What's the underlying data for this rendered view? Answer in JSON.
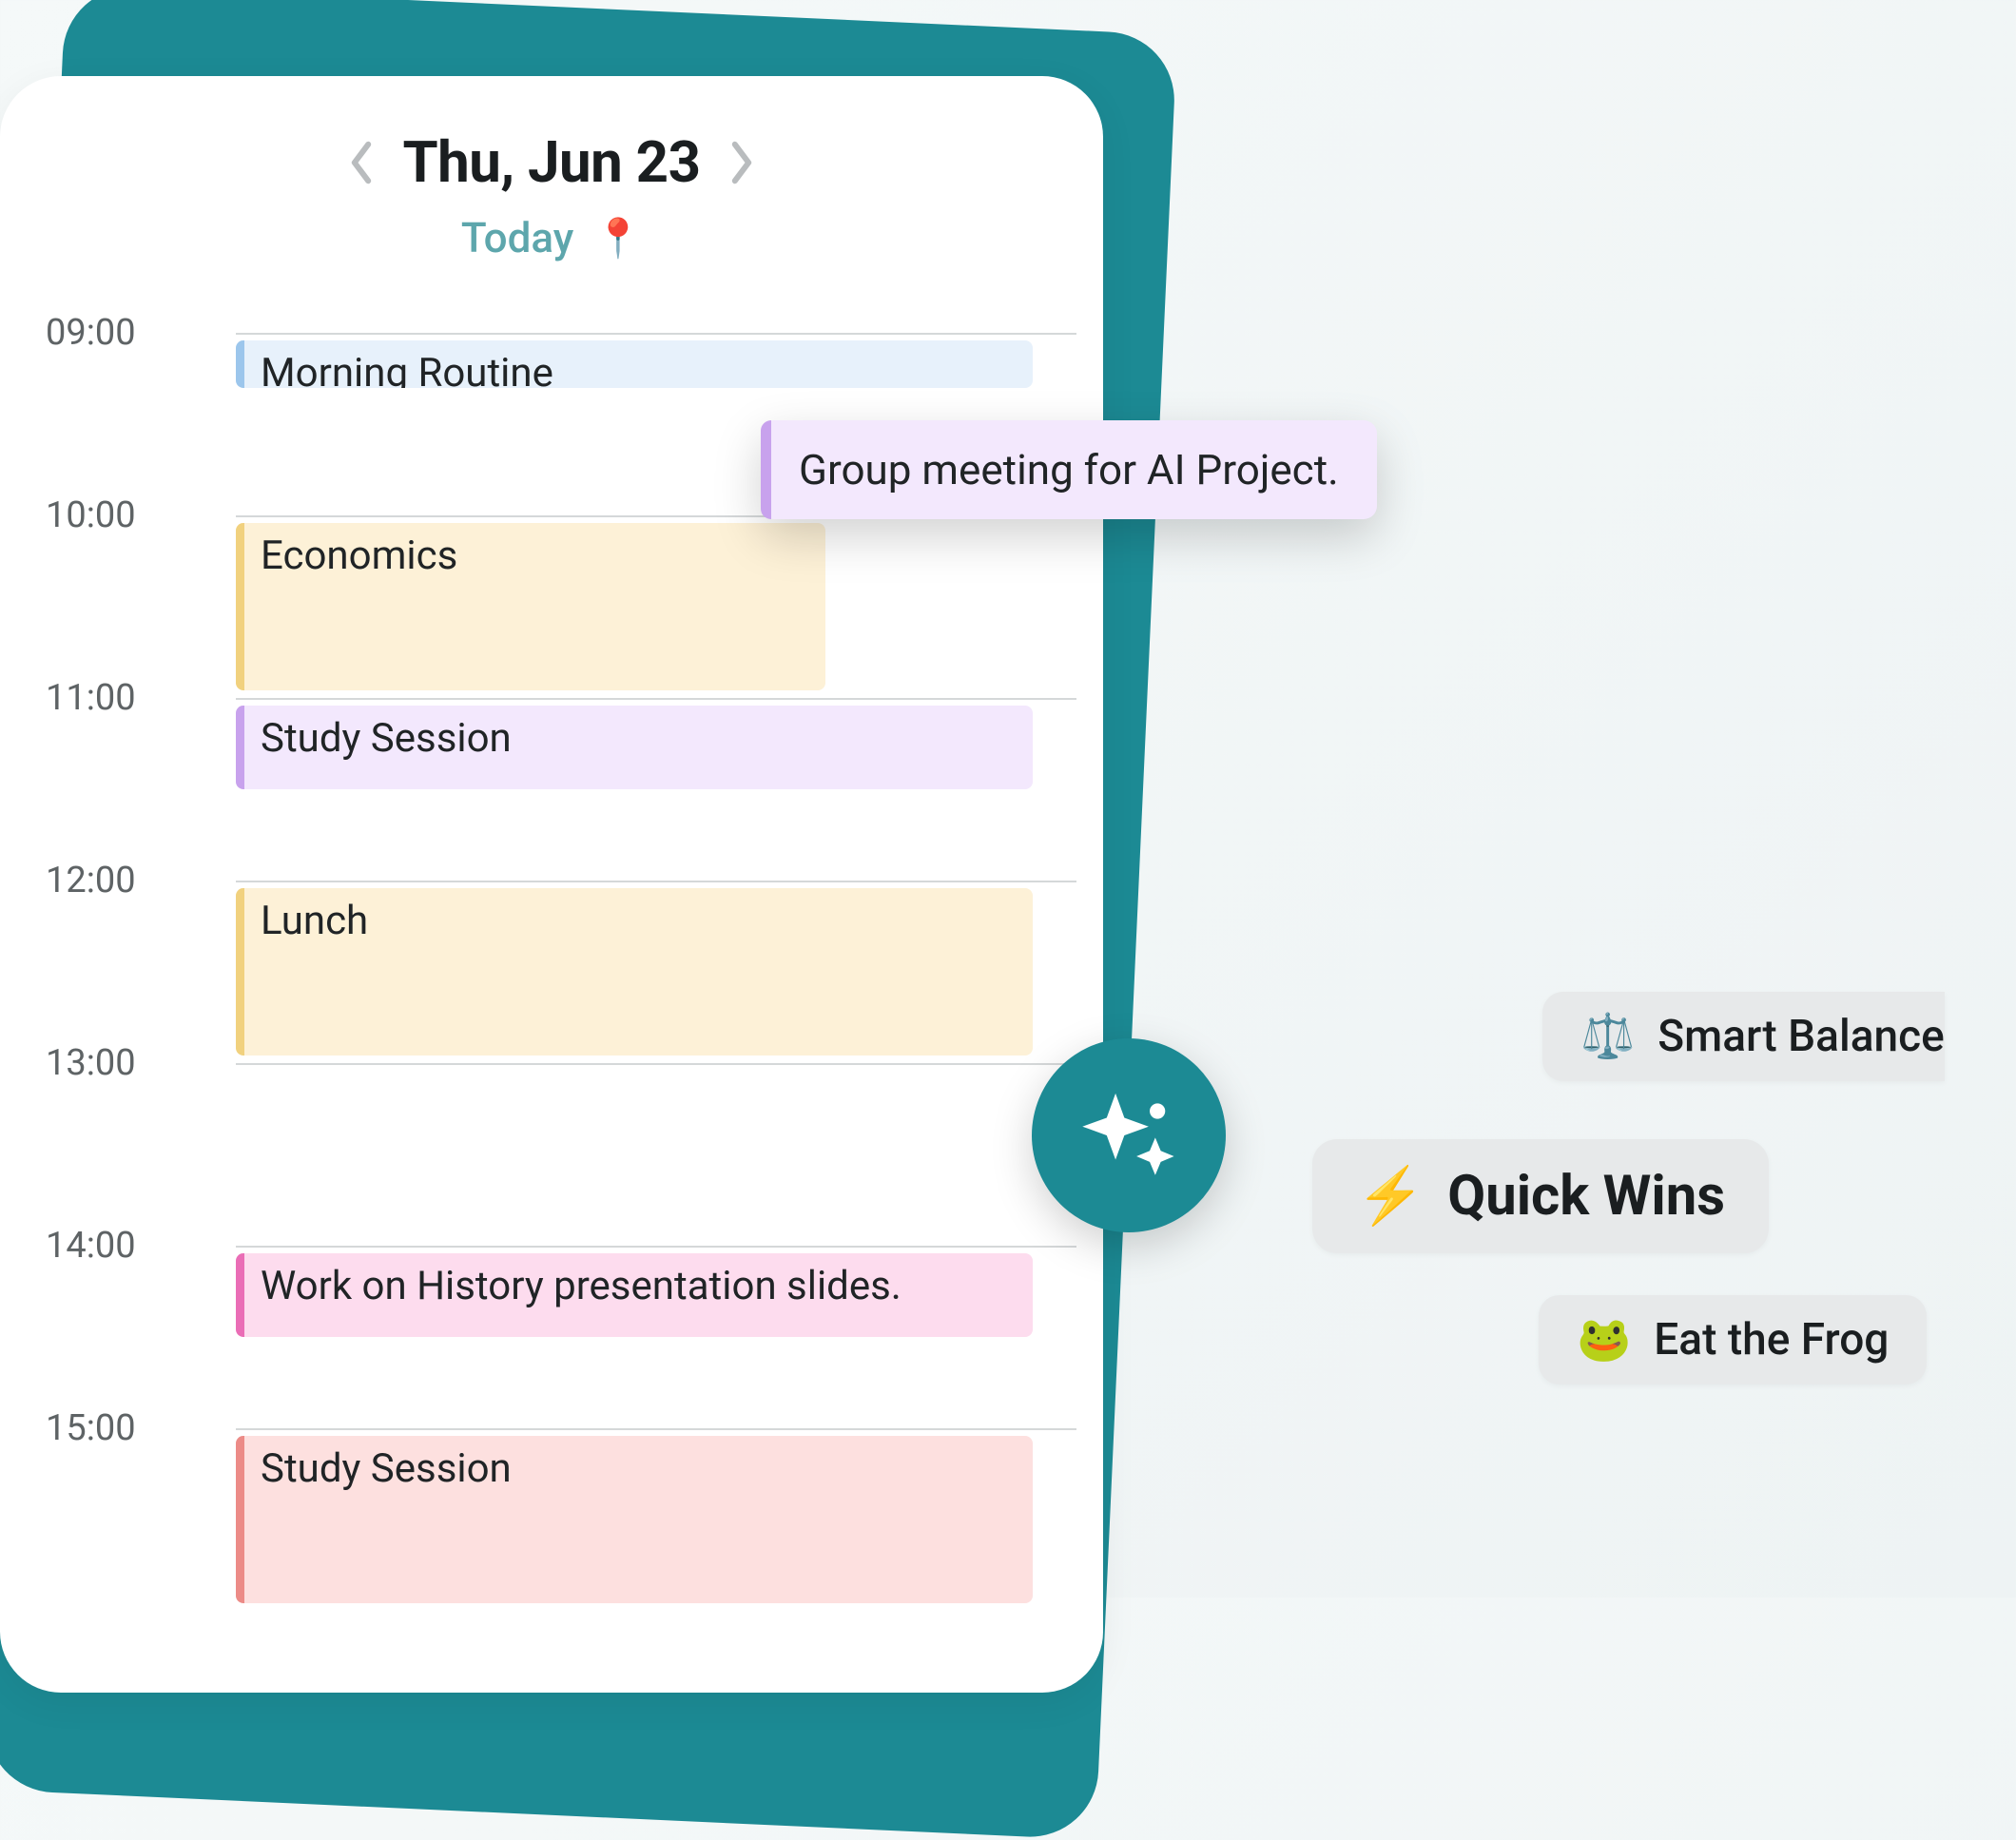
{
  "header": {
    "date": "Thu, Jun 23",
    "today_label": "Today",
    "pin_icon": "📍"
  },
  "hours": [
    "09:00",
    "10:00",
    "11:00",
    "12:00",
    "13:00",
    "14:00",
    "15:00"
  ],
  "events": {
    "morning_routine": "Morning Routine",
    "economics": "Economics",
    "study_session_1": "Study Session",
    "lunch": "Lunch",
    "history_slides": "Work on History presentation slides.",
    "study_session_2": "Study Session"
  },
  "floating_note": "Group meeting for AI Project.",
  "suggestions": {
    "balance": {
      "icon": "⚖️",
      "label": "Smart Balance"
    },
    "quick": {
      "icon": "⚡",
      "label": "Quick Wins"
    },
    "frog": {
      "icon": "🐸",
      "label": "Eat the Frog"
    }
  },
  "colors": {
    "teal": "#1c8a94",
    "blue_event": "#e7f1fb",
    "yellow_event": "#fdf1d7",
    "purple_event": "#f3e8fd",
    "pink_event": "#fddcee",
    "red_event": "#fde0df",
    "pill_bg": "#e7e9ea"
  }
}
